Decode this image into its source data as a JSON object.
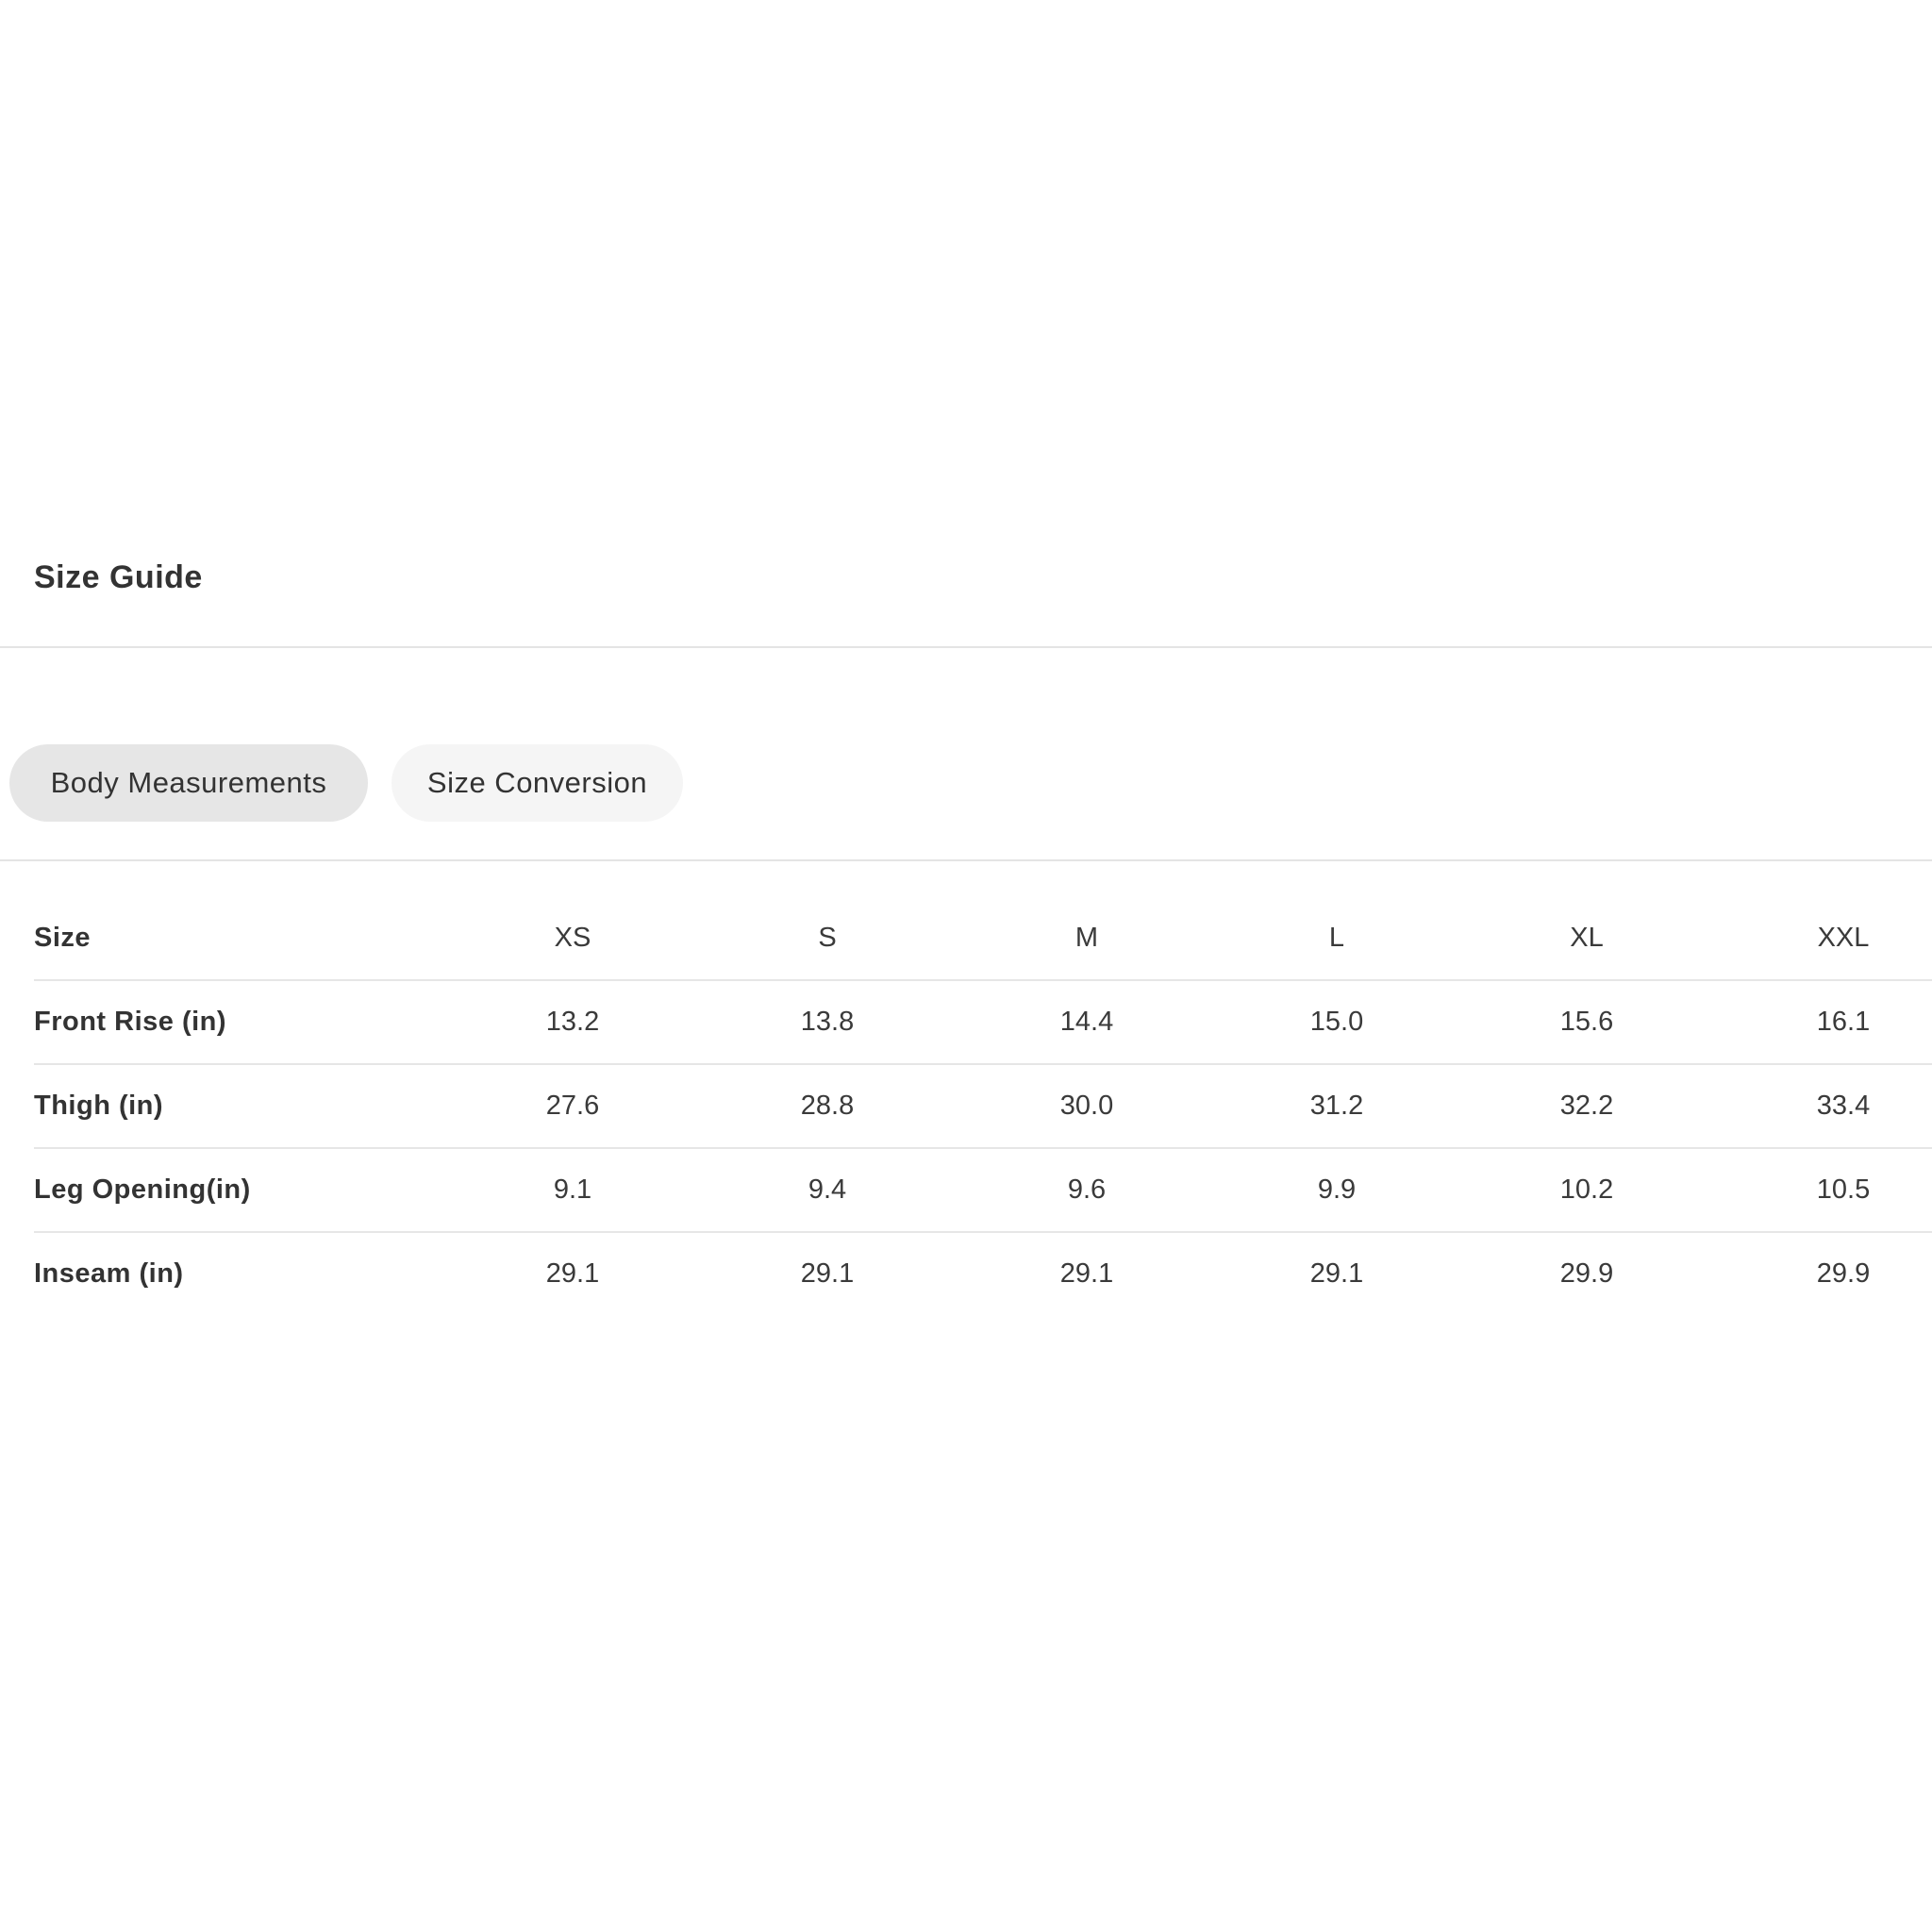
{
  "header": {
    "title": "Size Guide"
  },
  "tabs": [
    {
      "label": "Body Measurements",
      "active": true
    },
    {
      "label": "Size Conversion",
      "active": false
    }
  ],
  "table": {
    "header": {
      "label": "Size",
      "sizes": [
        "XS",
        "S",
        "M",
        "L",
        "XL",
        "XXL"
      ]
    },
    "rows": [
      {
        "label": "Front Rise (in)",
        "values": [
          "13.2",
          "13.8",
          "14.4",
          "15.0",
          "15.6",
          "16.1"
        ]
      },
      {
        "label": "Thigh (in)",
        "values": [
          "27.6",
          "28.8",
          "30.0",
          "31.2",
          "32.2",
          "33.4"
        ]
      },
      {
        "label": "Leg Opening(in)",
        "values": [
          "9.1",
          "9.4",
          "9.6",
          "9.9",
          "10.2",
          "10.5"
        ]
      },
      {
        "label": "Inseam (in)",
        "values": [
          "29.1",
          "29.1",
          "29.1",
          "29.1",
          "29.9",
          "29.9"
        ]
      }
    ]
  },
  "colors": {
    "text": "#333333",
    "active_tab_bg": "#e6e6e6",
    "inactive_tab_bg": "#f5f5f5",
    "divider": "#e4e4e4"
  }
}
